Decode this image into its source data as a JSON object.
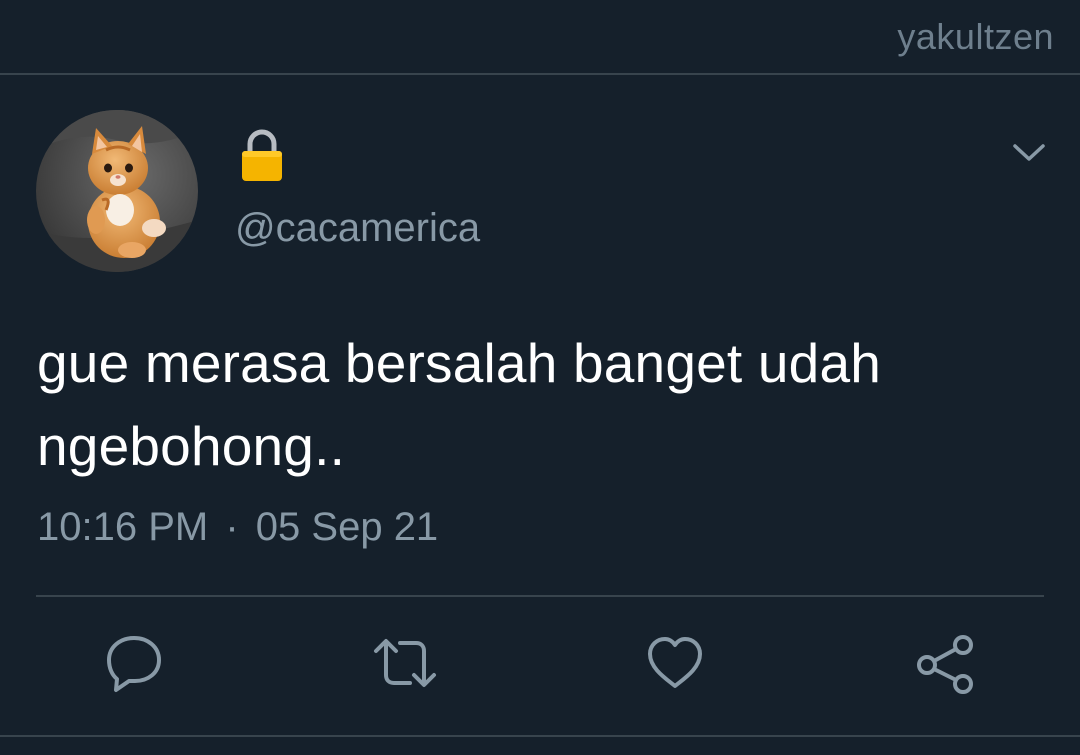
{
  "watermark": "yakultzen",
  "tweet": {
    "handle": "@cacamerica",
    "text": "gue merasa bersalah banget udah ngebohong..",
    "time": "10:16 PM",
    "separator": "·",
    "date": "05 Sep 21",
    "protected_icon": "lock-icon"
  },
  "actions": [
    {
      "name": "reply",
      "icon": "speech-bubble-icon"
    },
    {
      "name": "retweet",
      "icon": "retweet-icon"
    },
    {
      "name": "like",
      "icon": "heart-icon"
    },
    {
      "name": "share",
      "icon": "share-icon"
    }
  ],
  "colors": {
    "background": "#15202b",
    "divider": "#38444d",
    "secondary_text": "#8899a6",
    "primary_text": "#ffffff",
    "lock": "#f5b400"
  }
}
